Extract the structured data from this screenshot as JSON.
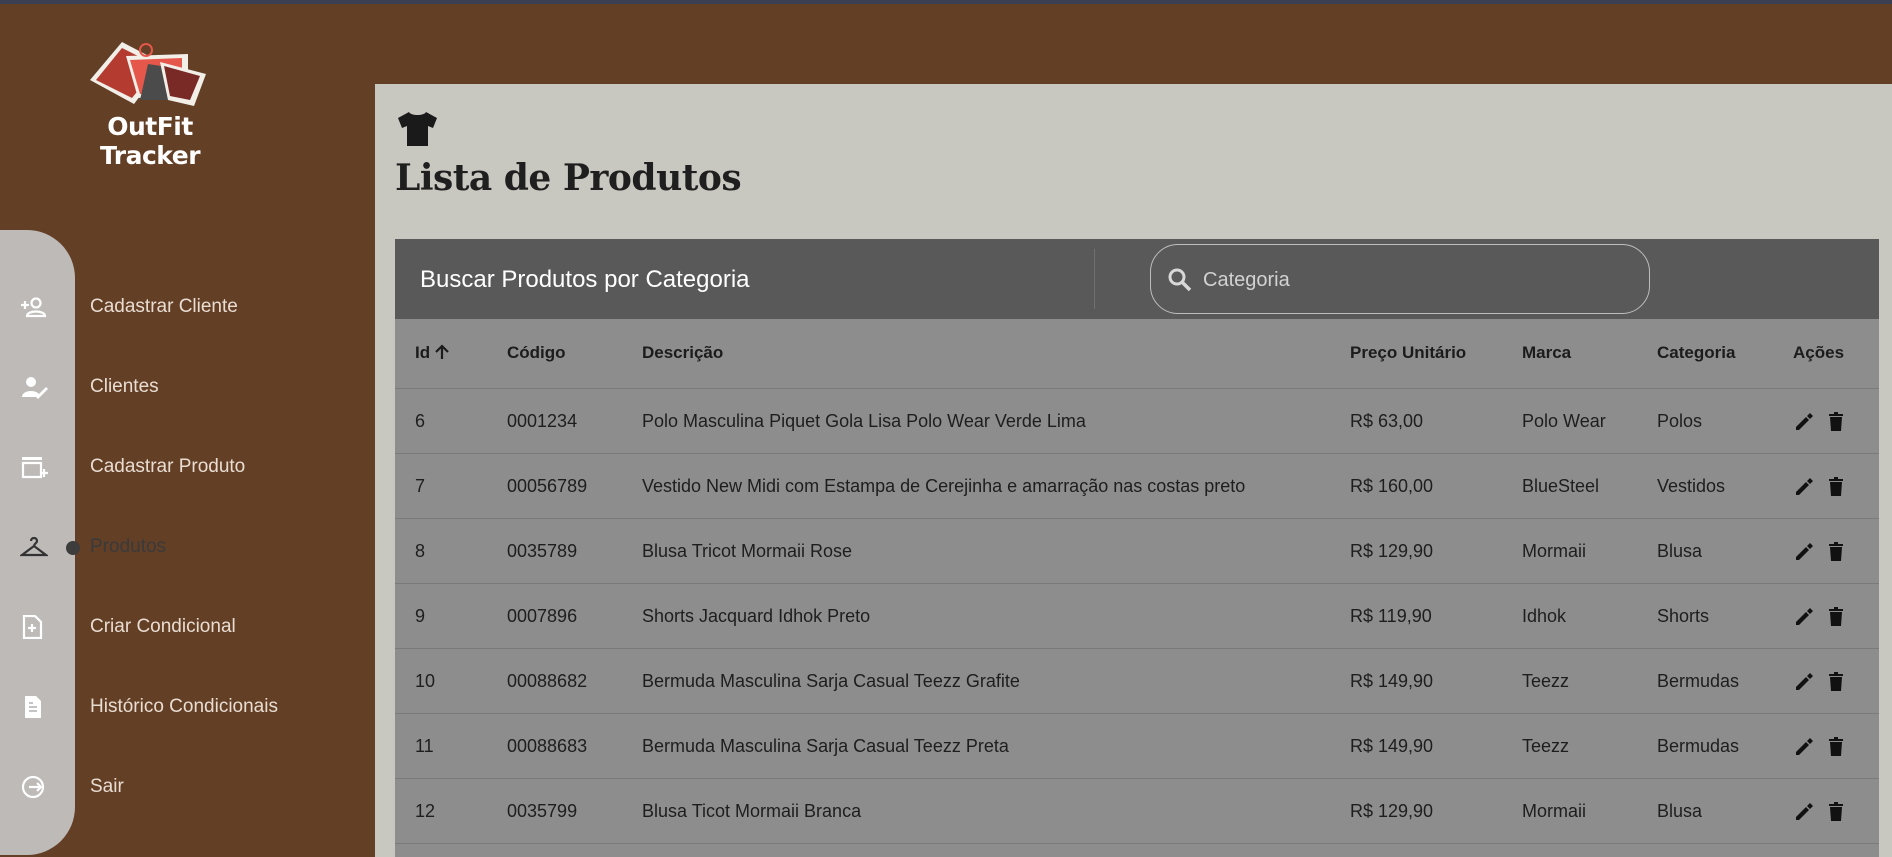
{
  "app": {
    "name": "OutFit Tracker"
  },
  "sidebar": {
    "items": [
      {
        "label": "Cadastrar Cliente",
        "icon": "person-add-icon"
      },
      {
        "label": "Clientes",
        "icon": "person-edit-icon"
      },
      {
        "label": "Cadastrar Produto",
        "icon": "store-add-icon"
      },
      {
        "label": "Produtos",
        "icon": "hanger-icon",
        "active": true
      },
      {
        "label": "Criar Condicional",
        "icon": "note-add-icon"
      },
      {
        "label": "Histórico Condicionais",
        "icon": "history-doc-icon"
      },
      {
        "label": "Sair",
        "icon": "logout-icon"
      }
    ]
  },
  "page": {
    "title": "Lista de Produtos",
    "icon": "tshirt-icon"
  },
  "toolbar": {
    "title": "Buscar Produtos por Categoria",
    "search_placeholder": "Categoria"
  },
  "table": {
    "columns": [
      "Id",
      "Código",
      "Descrição",
      "Preço Unitário",
      "Marca",
      "Categoria",
      "Ações"
    ],
    "sorted_by": "Id",
    "rows": [
      {
        "id": "6",
        "codigo": "0001234",
        "descricao": "Polo Masculina Piquet Gola Lisa Polo Wear Verde Lima",
        "preco": "R$ 63,00",
        "marca": "Polo Wear",
        "categoria": "Polos"
      },
      {
        "id": "7",
        "codigo": "00056789",
        "descricao": "Vestido New Midi com Estampa de Cerejinha e amarração nas costas preto",
        "preco": "R$ 160,00",
        "marca": "BlueSteel",
        "categoria": "Vestidos"
      },
      {
        "id": "8",
        "codigo": "0035789",
        "descricao": "Blusa Tricot Mormaii Rose",
        "preco": "R$ 129,90",
        "marca": "Mormaii",
        "categoria": "Blusa"
      },
      {
        "id": "9",
        "codigo": "0007896",
        "descricao": "Shorts Jacquard Idhok Preto",
        "preco": "R$ 119,90",
        "marca": "Idhok",
        "categoria": "Shorts"
      },
      {
        "id": "10",
        "codigo": "00088682",
        "descricao": "Bermuda Masculina Sarja Casual Teezz Grafite",
        "preco": "R$ 149,90",
        "marca": "Teezz",
        "categoria": "Bermudas"
      },
      {
        "id": "11",
        "codigo": "00088683",
        "descricao": "Bermuda Masculina Sarja Casual Teezz Preta",
        "preco": "R$ 149,90",
        "marca": "Teezz",
        "categoria": "Bermudas"
      },
      {
        "id": "12",
        "codigo": "0035799",
        "descricao": "Blusa Ticot Mormaii Branca",
        "preco": "R$ 129,90",
        "marca": "Mormaii",
        "categoria": "Blusa"
      }
    ],
    "actions": [
      "edit-icon",
      "delete-icon"
    ]
  },
  "colors": {
    "sidebar": "#633f26",
    "content_bg": "#c8c7c0",
    "toolbar": "#595959",
    "table": "#8d8d8d",
    "rail": "#c4c4c4"
  }
}
